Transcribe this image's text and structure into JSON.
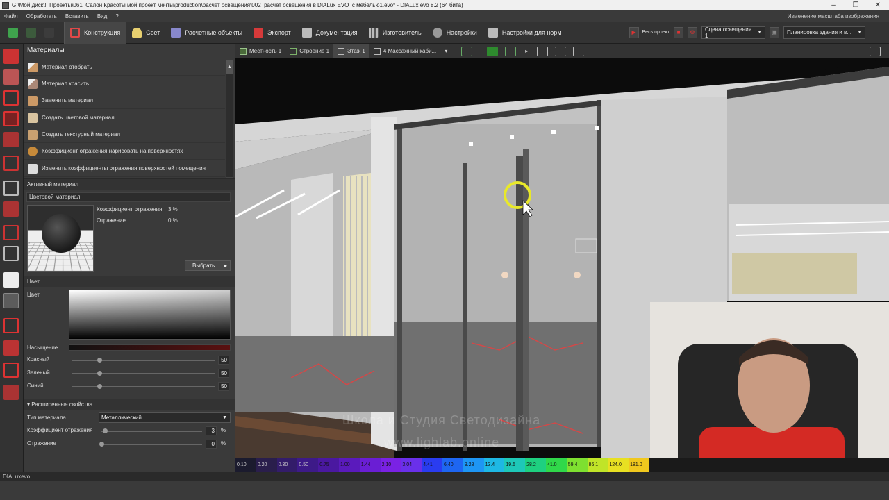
{
  "window": {
    "title": "G:\\Мой диск\\!_Проекты\\061_Салон Красоты мой проект мечты\\production\\расчет освещения\\002_расчет освещения в DIALux EVO_с мебелью1.evo* - DIALux evo 8.2  (64 бита)"
  },
  "menu": {
    "items": [
      "Файл",
      "Обработать",
      "Вставить",
      "Вид",
      "?"
    ],
    "right_hint": "Изменение масштаба изображения"
  },
  "toolbar": {
    "tabs": [
      {
        "label": "Конструкция",
        "color": "#e04848"
      },
      {
        "label": "Свет",
        "color": "#e8d070"
      },
      {
        "label": "Расчетные объекты",
        "color": "#8888cc"
      },
      {
        "label": "Экспорт",
        "color": "#d63a3a"
      },
      {
        "label": "Документация",
        "color": "#bbbbbb"
      },
      {
        "label": "Изготовитель",
        "color": "#bbbbbb"
      },
      {
        "label": "Настройки",
        "color": "#999999"
      },
      {
        "label": "Настройки для норм",
        "color": "#bbbbbb"
      }
    ],
    "whole_project": "Весь проект",
    "scene_select": "Сцена освещения 1",
    "layout_select": "Планировка здания и в..."
  },
  "panel": {
    "title": "Материалы",
    "actions": [
      "Материал отобрать",
      "Материал красить",
      "Заменить материал",
      "Создать цветовой материал",
      "Создать текстурный материал",
      "Коэффициент отражения нарисовать на поверхностях",
      "Изменить коэффициенты отражения поверхностей помещения"
    ],
    "active_material": {
      "header": "Активный материал",
      "type": "Цветовой материал",
      "reflectance_label": "Коэффициент отражения",
      "reflectance_value": "3 %",
      "reflection_label": "Отражение",
      "reflection_value": "0 %",
      "select_button": "Выбрать"
    },
    "color": {
      "header": "Цвет",
      "color_label": "Цвет",
      "saturation_label": "Насыщение",
      "red_label": "Красный",
      "red": "50",
      "green_label": "Зеленый",
      "green": "50",
      "blue_label": "Синий",
      "blue": "50"
    },
    "advanced": {
      "header": "Расширенные свойства",
      "material_type_label": "Тип материала",
      "material_type": "Металлический",
      "reflectance_label": "Коэффициент отражения",
      "reflectance": "3",
      "reflection_label": "Отражение",
      "reflection": "0",
      "unit": "%"
    }
  },
  "viewbar": {
    "crumbs": [
      "Местность 1",
      "Строение 1",
      "Этаж 1",
      "4 Массажный каби..."
    ]
  },
  "viewport": {
    "watermark1": "Школа и Студия Светодизайна",
    "watermark2": "www.lighlab.online"
  },
  "legend": {
    "values": [
      "0.10",
      "0.20",
      "0.30",
      "0.50",
      "0.75",
      "1.00",
      "1.44",
      "2.10",
      "3.04",
      "4.41",
      "6.40",
      "9.28",
      "13.4",
      "19.5",
      "28.2",
      "41.0",
      "59.4",
      "86.1",
      "124.0",
      "181.0"
    ],
    "colors": [
      "#1b1b2e",
      "#2a1e4c",
      "#331c6a",
      "#3d1a88",
      "#4a18a0",
      "#5a1abc",
      "#6a1ed4",
      "#7a22e4",
      "#6a30ea",
      "#2a3cf0",
      "#1e66f2",
      "#1e96f4",
      "#1eb8e4",
      "#1ec8b8",
      "#1ed080",
      "#30d84a",
      "#7ee030",
      "#c0e428",
      "#e8e022",
      "#f0c81e"
    ]
  },
  "status": {
    "text": "DIALuxevo"
  }
}
